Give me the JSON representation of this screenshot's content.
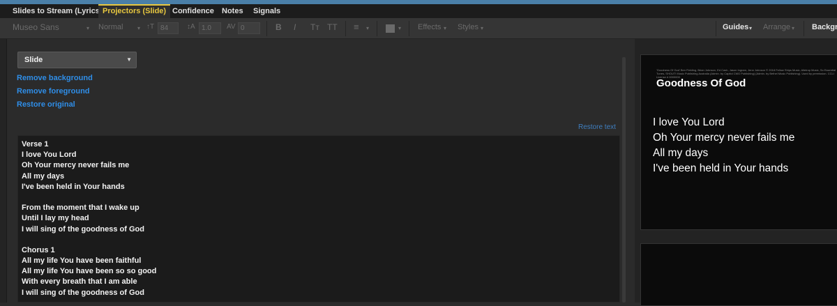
{
  "tabs": [
    {
      "label": "Slides to Stream (Lyrics)"
    },
    {
      "label": "Projectors (Slide)"
    },
    {
      "label": "Confidence"
    },
    {
      "label": "Notes"
    },
    {
      "label": "Signals"
    }
  ],
  "toolbar": {
    "font_family": "Museo Sans",
    "font_weight": "Normal",
    "font_size": "84",
    "line_height": "1.0",
    "char_spacing": "0",
    "bold": "B",
    "italic": "I",
    "text_small_caps": "Tт",
    "text_all_caps": "TT",
    "effects": "Effects",
    "styles": "Styles",
    "guides": "Guides",
    "arrange": "Arrange",
    "background": "Background"
  },
  "editor": {
    "slide_select": "Slide",
    "remove_background": "Remove background",
    "remove_foreground": "Remove foreground",
    "restore_original": "Restore original",
    "restore_text": "Restore text",
    "lyrics": [
      [
        "Verse 1",
        "I love You Lord",
        "Oh Your mercy never fails me",
        "All my days",
        "I've been held in Your hands"
      ],
      [
        "From the moment that I wake up",
        "Until I lay my head",
        "I will sing of the goodness of God"
      ],
      [
        "Chorus 1",
        "All my life You have been faithful",
        "All my life You have been so so good",
        "With every breath that I am able",
        "I will sing of the goodness of God"
      ]
    ]
  },
  "preview": {
    "copyright": "'Goodness Of God' Ben Fielding, Brian Johnson, Ed Cash, Jason Ingram, Jenn Johnson © 2018 Fellow Ships Music, Alletrop Music, So Essential Tunes, SHOUT! Music Publishing Australia (Admin. by Capitol CMG Publishing) (Admin. by Bethel Music Publishing). Used by permission. CCLI License # 0000000",
    "title": "Goodness Of God",
    "lines": [
      "I love You Lord",
      "Oh Your mercy never fails me",
      "All my days",
      "I've been held in Your hands"
    ]
  },
  "colors": {
    "accent_tab": "#e8c840",
    "link": "#2f8ee8"
  }
}
